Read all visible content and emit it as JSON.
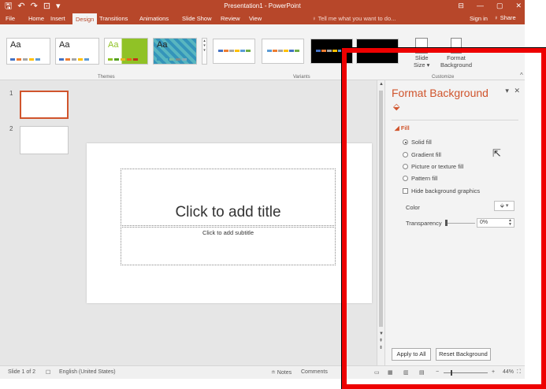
{
  "title_bar": {
    "title": "Presentation1 - PowerPoint",
    "qat": {
      "save": "🖫",
      "undo": "↶",
      "redo": "↷",
      "present": "⊡",
      "more": "▾"
    },
    "controls": {
      "ribbon_options": "⊟",
      "minimize": "—",
      "restore": "▢",
      "close": "✕"
    }
  },
  "ribbon_tabs": {
    "file": "File",
    "home": "Home",
    "insert": "Insert",
    "design": "Design",
    "transitions": "Transitions",
    "animations": "Animations",
    "slide_show": "Slide Show",
    "review": "Review",
    "view": "View",
    "tell_me": "♀ Tell me what you want to do...",
    "sign_in": "Sign in",
    "share": "♀ Share"
  },
  "ribbon": {
    "themes": [
      {
        "label": "Aa",
        "bars": [
          "#4472c4",
          "#ed7d31",
          "#a5a5a5",
          "#ffc000",
          "#5b9bd5"
        ],
        "text_color": "#222222"
      },
      {
        "label": "Aa",
        "bars": [
          "#4472c4",
          "#ed7d31",
          "#a5a5a5",
          "#ffc000",
          "#5b9bd5"
        ],
        "text_color": "#222222"
      },
      {
        "label": "Aa",
        "bars": [
          "#90c226",
          "#54a021",
          "#e6b91e",
          "#e76618",
          "#c42f1a"
        ],
        "text_color": "#ffffff"
      },
      {
        "label": "Aa",
        "bars": [
          "#3494ba",
          "#58b6c0",
          "#75bda7",
          "#7a8c8e",
          "#84acb6"
        ],
        "text_color": "#222222"
      }
    ],
    "themes_label": "Themes",
    "variants": [
      {
        "bars": [
          "#4472c4",
          "#ed7d31",
          "#a5a5a5",
          "#ffc000",
          "#5b9bd5",
          "#70ad47"
        ]
      },
      {
        "bars": [
          "#5b9bd5",
          "#ed7d31",
          "#a5a5a5",
          "#ffc000",
          "#4472c4",
          "#70ad47"
        ]
      },
      {
        "bars": [
          "#4472c4",
          "#ed7d31",
          "#a5a5a5",
          "#ffc000",
          "#5b9bd5",
          "#70ad47"
        ]
      },
      {
        "bars": [
          "#4472c4",
          "#ed7d31",
          "#a5a5a5",
          "#ffc000",
          "#5b9bd5",
          "#70ad47"
        ]
      }
    ],
    "variants_label": "Variants",
    "slide_size": "Slide\nSize ▾",
    "format_background": "Format\nBackground",
    "customize_label": "Customize",
    "collapse": "^"
  },
  "slides_pane": {
    "slides": [
      {
        "number": "1"
      },
      {
        "number": "2"
      }
    ]
  },
  "slide": {
    "title_placeholder": "Click to add title",
    "subtitle_placeholder": "Click to add subtitle"
  },
  "format_pane": {
    "title": "Format Background",
    "dropdown": "▾",
    "close": "✕",
    "fill_icon": "⬙",
    "section": "◢ Fill",
    "options": {
      "solid": "Solid fill",
      "gradient": "Gradient fill",
      "picture": "Picture or texture fill",
      "pattern": "Pattern fill"
    },
    "selected_option": "solid",
    "hide_background_graphics": "Hide background graphics",
    "color_label": "Color",
    "color_button": "⬙ ▾",
    "transparency_label": "Transparency",
    "transparency_value": "0%",
    "transparency_fraction": 0,
    "apply_to_all": "Apply to All",
    "reset_background": "Reset Background"
  },
  "status_bar": {
    "slide_count": "Slide 1 of 2",
    "language": "English (United States)",
    "notes": "≐ Notes",
    "comments": "Comments",
    "zoom_minus": "−",
    "zoom_plus": "+",
    "zoom": "44%",
    "fit": "⛶"
  },
  "colors": {
    "accent": "#b7472a",
    "pane_accent": "#d0542c",
    "highlight_frame": "#ee0000"
  }
}
